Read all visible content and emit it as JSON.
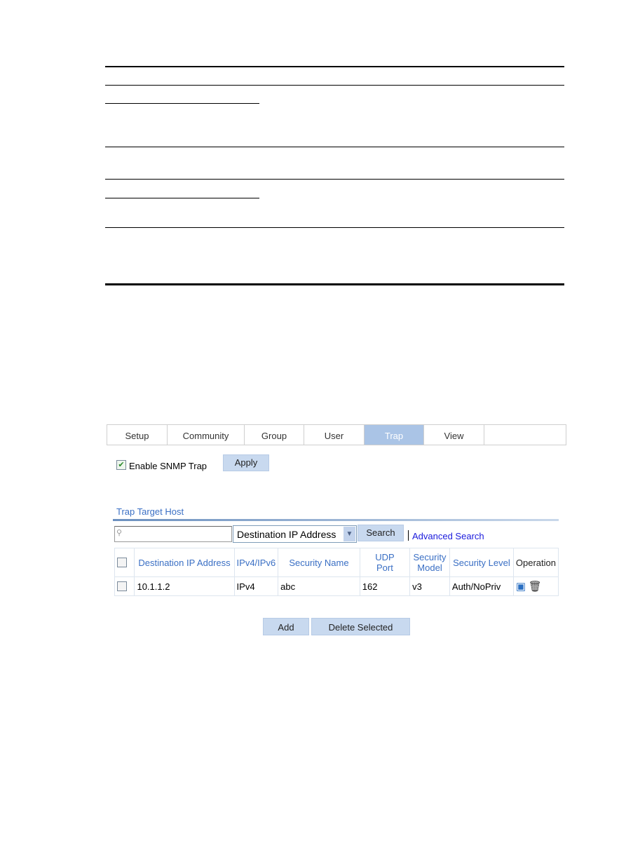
{
  "tabs": [
    "Setup",
    "Community",
    "Group",
    "User",
    "Trap",
    "View"
  ],
  "active_tab": "Trap",
  "enable_trap": {
    "label": "Enable SNMP Trap",
    "checked": true
  },
  "apply_label": "Apply",
  "section_title": "Trap Target Host",
  "search": {
    "value": "",
    "field_selected": "Destination IP Address",
    "button": "Search",
    "advanced": "Advanced Search"
  },
  "table": {
    "headers": [
      "Destination IP Address",
      "IPv4/IPv6",
      "Security Name",
      "UDP Port",
      "Security Model",
      "Security Level",
      "Operation"
    ],
    "rows": [
      {
        "dest": "10.1.1.2",
        "ipver": "IPv4",
        "name": "abc",
        "port": "162",
        "model": "v3",
        "level": "Auth/NoPriv"
      }
    ]
  },
  "buttons": {
    "add": "Add",
    "delete": "Delete Selected"
  },
  "colors": {
    "active_tab": "#aac4e6",
    "header_text": "#3a6fc4",
    "link": "#1a1adc"
  }
}
